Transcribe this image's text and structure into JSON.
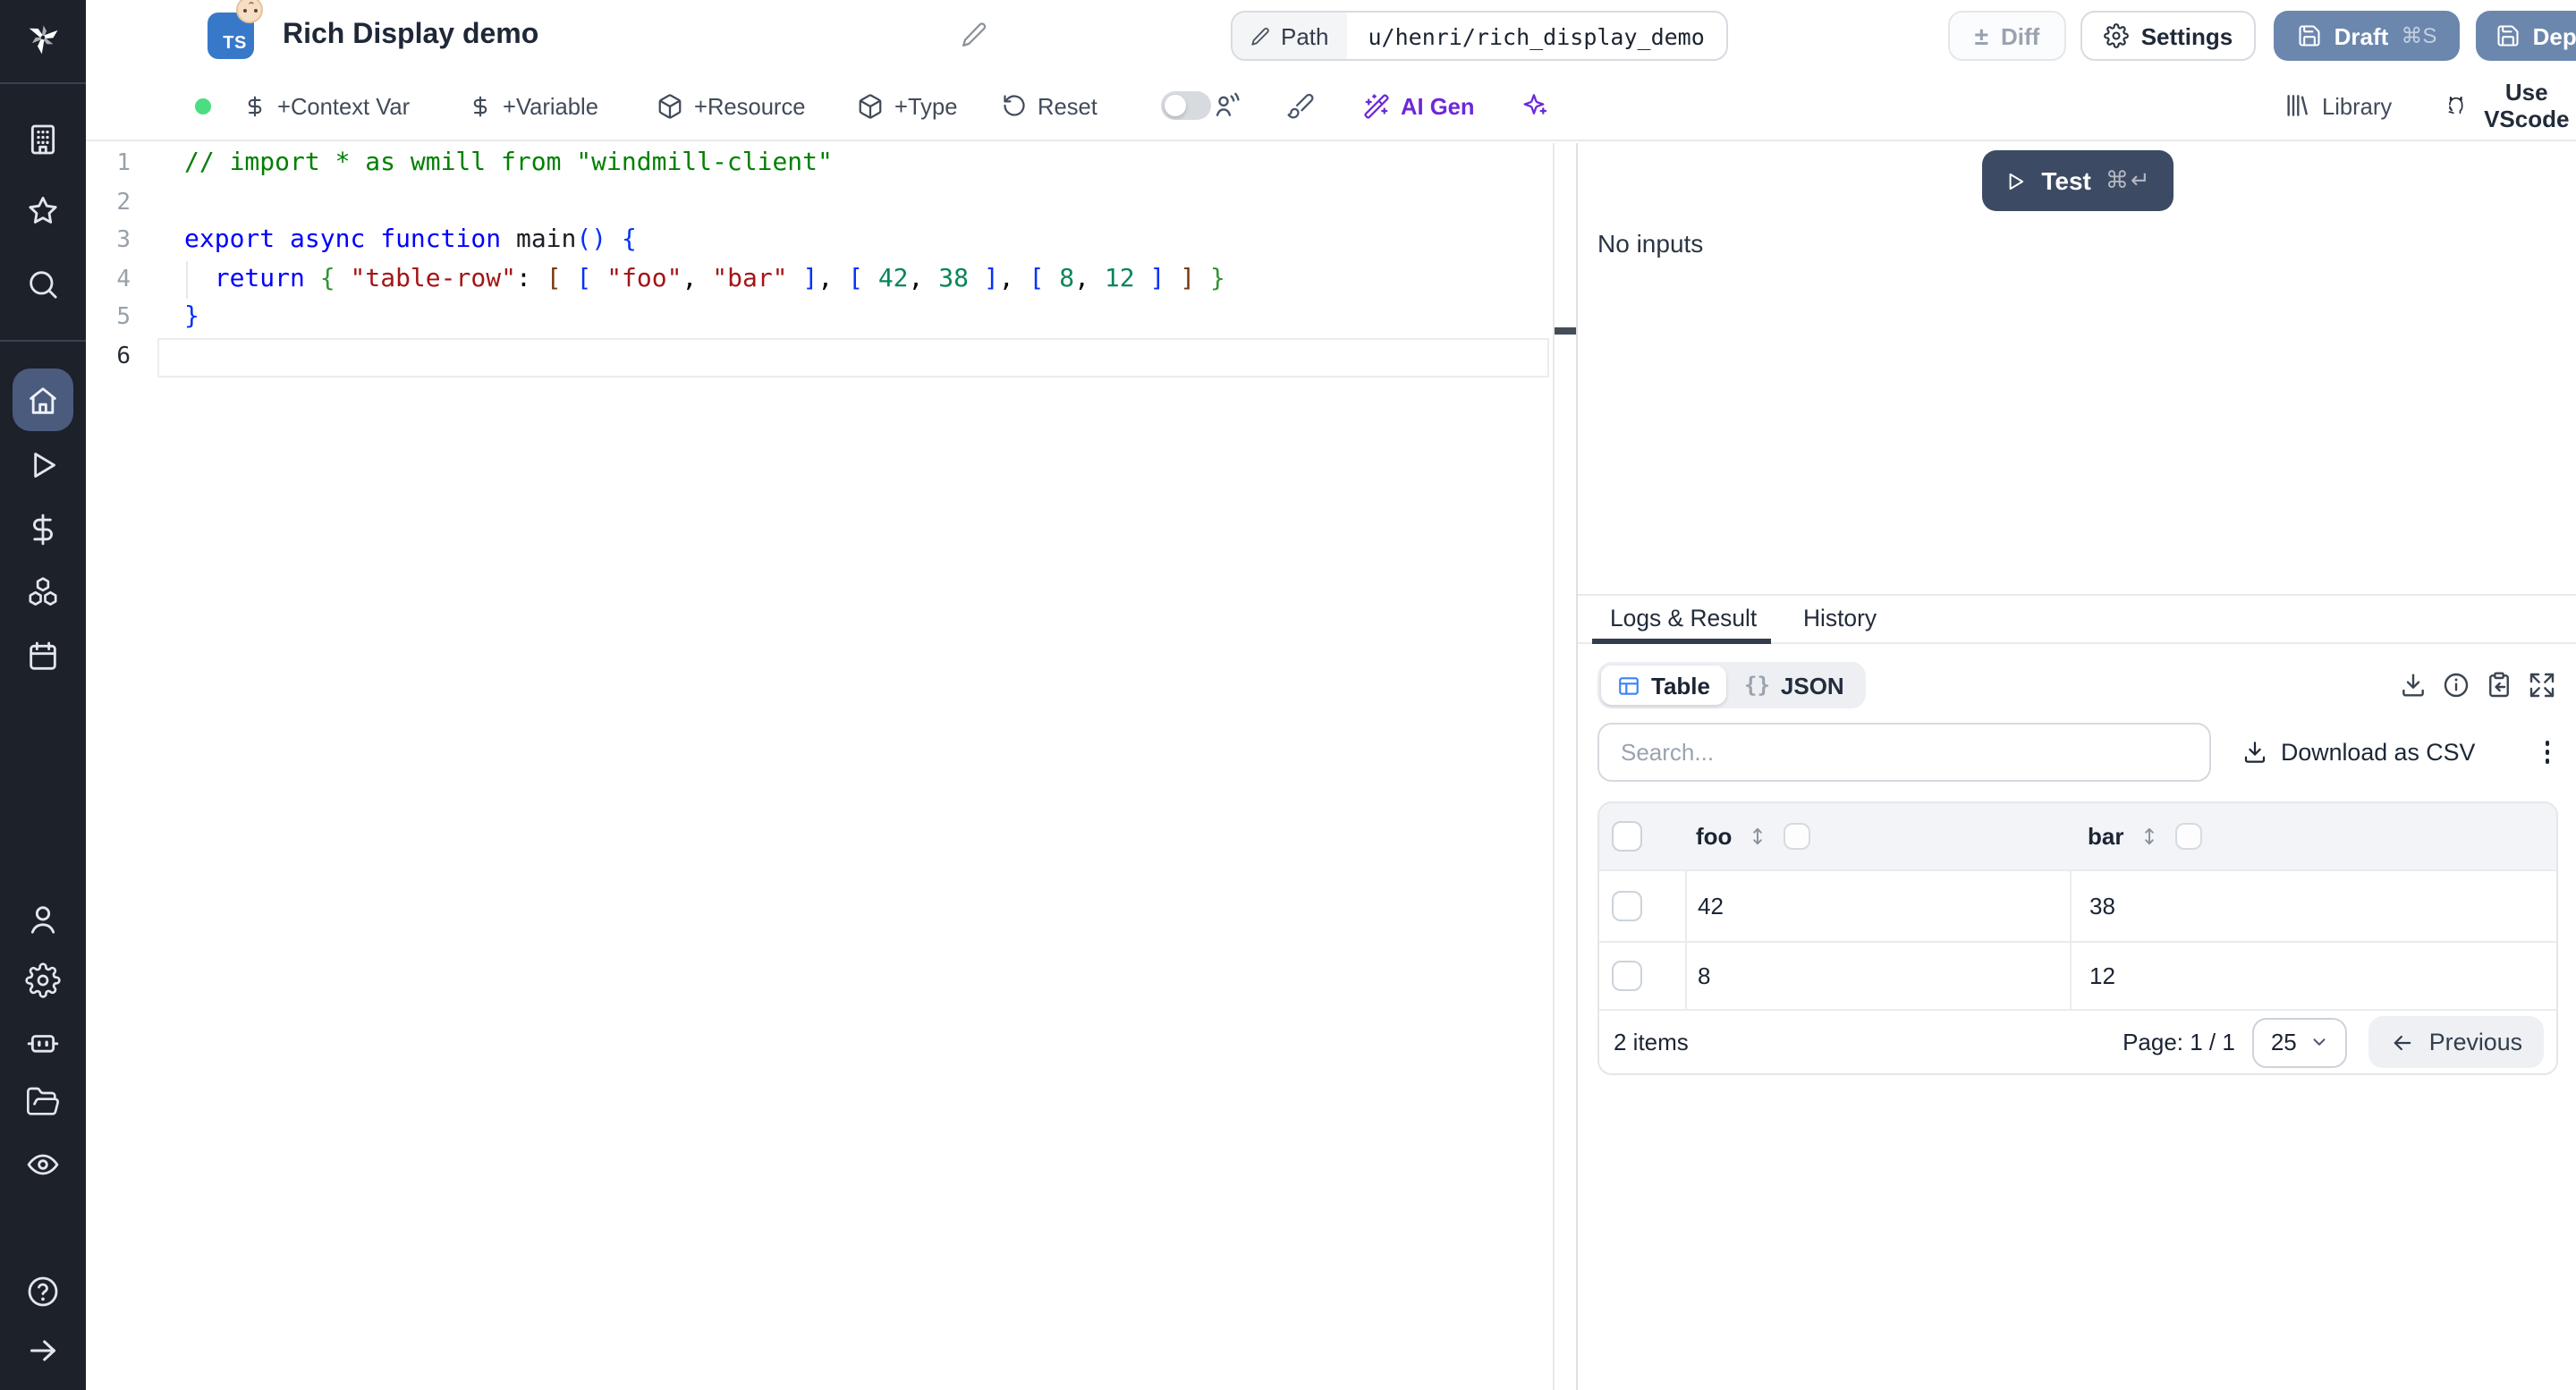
{
  "header": {
    "title": "Rich Display demo",
    "language_badge": "TS",
    "path_label": "Path",
    "path_value": "u/henri/rich_display_demo",
    "diff_label": "Diff",
    "diff_icon": "±",
    "settings_label": "Settings",
    "draft_label": "Draft",
    "draft_shortcut": "⌘S",
    "deploy_label": "Deploy"
  },
  "toolbar": {
    "add_context_var": "+Context Var",
    "add_variable": "+Variable",
    "add_resource": "+Resource",
    "add_type": "+Type",
    "reset": "Reset",
    "ai_gen": "AI Gen",
    "library": "Library",
    "use_vscode": "Use VScode"
  },
  "sidebar": {
    "icons": [
      "windmill-logo",
      "building",
      "star",
      "search",
      "home",
      "play",
      "dollar",
      "boxes",
      "calendar",
      "user",
      "gear",
      "robot",
      "folder-open",
      "eye",
      "help",
      "expand-arrow"
    ],
    "active": "home"
  },
  "editor": {
    "lines": [
      {
        "num": "1",
        "tokens": [
          {
            "t": "// import * as wmill from \"windmill-client\"",
            "c": "comment"
          }
        ]
      },
      {
        "num": "2",
        "tokens": []
      },
      {
        "num": "3",
        "tokens": [
          {
            "t": "export",
            "c": "kw"
          },
          {
            "t": " "
          },
          {
            "t": "async",
            "c": "kw"
          },
          {
            "t": " "
          },
          {
            "t": "function",
            "c": "kw"
          },
          {
            "t": " "
          },
          {
            "t": "main",
            "c": "id"
          },
          {
            "t": "(",
            "c": "b1"
          },
          {
            "t": ")",
            "c": "b1"
          },
          {
            "t": " "
          },
          {
            "t": "{",
            "c": "b1"
          }
        ]
      },
      {
        "num": "4",
        "tokens": [
          {
            "t": "  "
          },
          {
            "t": "return",
            "c": "kw"
          },
          {
            "t": " "
          },
          {
            "t": "{",
            "c": "b2"
          },
          {
            "t": " "
          },
          {
            "t": "\"table-row\"",
            "c": "str"
          },
          {
            "t": ":",
            "c": "pn"
          },
          {
            "t": " "
          },
          {
            "t": "[",
            "c": "b3"
          },
          {
            "t": " "
          },
          {
            "t": "[",
            "c": "b1"
          },
          {
            "t": " "
          },
          {
            "t": "\"foo\"",
            "c": "str"
          },
          {
            "t": ",",
            "c": "pn"
          },
          {
            "t": " "
          },
          {
            "t": "\"bar\"",
            "c": "str"
          },
          {
            "t": " "
          },
          {
            "t": "]",
            "c": "b1"
          },
          {
            "t": ",",
            "c": "pn"
          },
          {
            "t": " "
          },
          {
            "t": "[",
            "c": "b1"
          },
          {
            "t": " "
          },
          {
            "t": "42",
            "c": "num"
          },
          {
            "t": ",",
            "c": "pn"
          },
          {
            "t": " "
          },
          {
            "t": "38",
            "c": "num"
          },
          {
            "t": " "
          },
          {
            "t": "]",
            "c": "b1"
          },
          {
            "t": ",",
            "c": "pn"
          },
          {
            "t": " "
          },
          {
            "t": "[",
            "c": "b1"
          },
          {
            "t": " "
          },
          {
            "t": "8",
            "c": "num"
          },
          {
            "t": ",",
            "c": "pn"
          },
          {
            "t": " "
          },
          {
            "t": "12",
            "c": "num"
          },
          {
            "t": " "
          },
          {
            "t": "]",
            "c": "b1"
          },
          {
            "t": " "
          },
          {
            "t": "]",
            "c": "b3"
          },
          {
            "t": " "
          },
          {
            "t": "}",
            "c": "b2"
          }
        ]
      },
      {
        "num": "5",
        "tokens": [
          {
            "t": "}",
            "c": "b1"
          }
        ]
      },
      {
        "num": "6",
        "tokens": [],
        "active": true
      }
    ]
  },
  "run_panel": {
    "test_label": "Test",
    "shortcut": "⌘↵",
    "no_inputs": "No inputs"
  },
  "results": {
    "tabs": [
      {
        "label": "Logs & Result",
        "active": true
      },
      {
        "label": "History",
        "active": false
      }
    ],
    "view_toggle": {
      "table": "Table",
      "json": "JSON",
      "json_icon": "{}"
    },
    "search_placeholder": "Search...",
    "download_csv": "Download as CSV",
    "table": {
      "columns": [
        "foo",
        "bar"
      ],
      "rows": [
        [
          "42",
          "38"
        ],
        [
          "8",
          "12"
        ]
      ]
    },
    "footer": {
      "items": "2 items",
      "page": "Page: 1 / 1",
      "page_size": "25",
      "previous": "Previous"
    }
  },
  "colors": {
    "accent_blue": "#3b82f6",
    "brand_purple": "#6d28d9",
    "deploy_button": "#6b87ae",
    "test_button": "#3d4a63",
    "sidebar_bg": "#1c212a",
    "active_nav_bg": "#4a5b7e",
    "status_green": "#4ade80",
    "ts_badge_blue": "#3878c8"
  }
}
